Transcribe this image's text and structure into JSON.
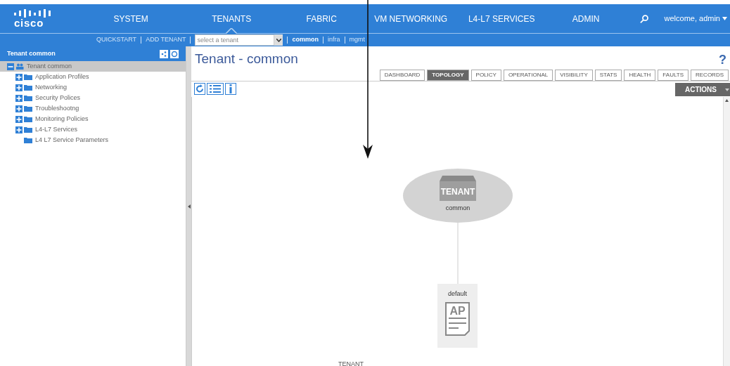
{
  "nav": {
    "logo": "cisco",
    "items": [
      {
        "label": "SYSTEM",
        "selected": false
      },
      {
        "label": "TENANTS",
        "selected": true
      },
      {
        "label": "FABRIC",
        "selected": false
      },
      {
        "label": "VM NETWORKING",
        "selected": false
      },
      {
        "label": "L4-L7 SERVICES",
        "selected": false
      },
      {
        "label": "ADMIN",
        "selected": false
      }
    ],
    "user": "welcome, admin"
  },
  "subnav": {
    "links": [
      "QUICKSTART",
      "ADD TENANT"
    ],
    "tenant_select": {
      "placeholder": "select a tenant"
    },
    "tenants": [
      {
        "label": "common",
        "selected": true
      },
      {
        "label": "infra",
        "selected": false
      },
      {
        "label": "mgmt",
        "selected": false
      }
    ]
  },
  "sidebar": {
    "title": "Tenant common",
    "tree": [
      {
        "label": "Tenant common",
        "kind": "group",
        "expanded": true,
        "children": [
          {
            "label": "Application Profiles",
            "kind": "group",
            "expanded": false
          },
          {
            "label": "Networking",
            "kind": "group",
            "expanded": false
          },
          {
            "label": "Security Polices",
            "kind": "group",
            "expanded": false
          },
          {
            "label": "Troubleshootng",
            "kind": "group",
            "expanded": false
          },
          {
            "label": "Monitoring Policies",
            "kind": "group",
            "expanded": false
          },
          {
            "label": "L4-L7 Services",
            "kind": "group",
            "expanded": false
          },
          {
            "label": "L4 L7 Service Parameters",
            "kind": "leaf"
          }
        ]
      }
    ]
  },
  "main": {
    "title": "Tenant - common",
    "help": "?",
    "tabs": [
      {
        "label": "DASHBOARD",
        "selected": false
      },
      {
        "label": "TOPOLOGY",
        "selected": true
      },
      {
        "label": "POLICY",
        "selected": false
      },
      {
        "label": "OPERATIONAL",
        "selected": false
      },
      {
        "label": "VISIBILITY",
        "selected": false
      },
      {
        "label": "STATS",
        "selected": false
      },
      {
        "label": "HEALTH",
        "selected": false
      },
      {
        "label": "FAULTS",
        "selected": false
      },
      {
        "label": "RECORDS",
        "selected": false
      }
    ],
    "actions": "ACTIONS",
    "topology": {
      "tenant": {
        "badge": "TENANT",
        "name": "common"
      },
      "profile": {
        "name": "default",
        "badge": "AP"
      },
      "footer": "TENANT"
    }
  }
}
